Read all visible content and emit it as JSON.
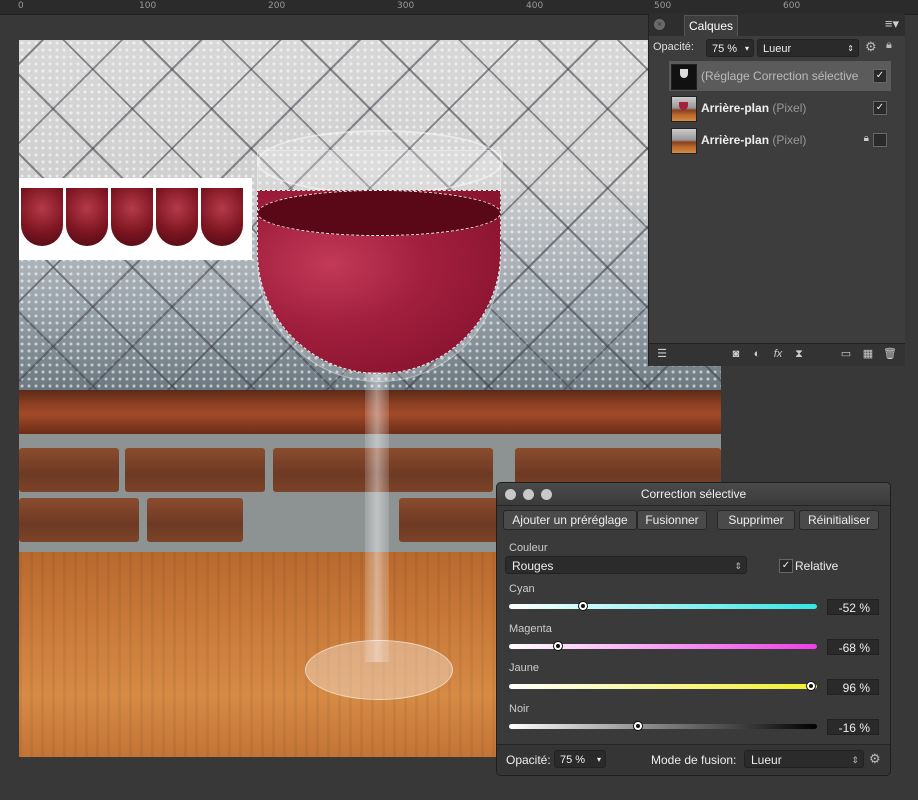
{
  "ruler": {
    "labels": [
      "0",
      "100",
      "200",
      "300",
      "400",
      "500",
      "600"
    ]
  },
  "layers_panel": {
    "tab": "Calques",
    "opacity_label": "Opacité:",
    "opacity_value": "75 %",
    "blend_mode": "Lueur",
    "layers": [
      {
        "name": "(Réglage Correction sélective",
        "kind": "",
        "checked": "✓"
      },
      {
        "name": "Arrière-plan",
        "kind": "(Pixel)",
        "checked": "✓"
      },
      {
        "name": "Arrière-plan",
        "kind": "(Pixel)",
        "checked": ""
      }
    ]
  },
  "dialog": {
    "title": "Correction sélective",
    "buttons": {
      "add_preset": "Ajouter un préréglage",
      "merge": "Fusionner",
      "delete": "Supprimer",
      "reset": "Réinitialiser"
    },
    "color_label": "Couleur",
    "color_value": "Rouges",
    "relative_label": "Relative",
    "relative_checked": "✓",
    "sliders": [
      {
        "label": "Cyan",
        "value": "-52 %",
        "level": -52,
        "colors": [
          "#ffffff",
          "#35e6e6"
        ]
      },
      {
        "label": "Magenta",
        "value": "-68 %",
        "level": -68,
        "colors": [
          "#ffffff",
          "#ef3ee6"
        ]
      },
      {
        "label": "Jaune",
        "value": "96 %",
        "level": 96,
        "colors": [
          "#ffffff",
          "#f0ef2c"
        ]
      },
      {
        "label": "Noir",
        "value": "-16 %",
        "level": -16,
        "colors": [
          "#ffffff",
          "#000000"
        ]
      }
    ],
    "opacity_label": "Opacité:",
    "opacity_value": "75 %",
    "blend_label": "Mode de fusion:",
    "blend_value": "Lueur"
  }
}
